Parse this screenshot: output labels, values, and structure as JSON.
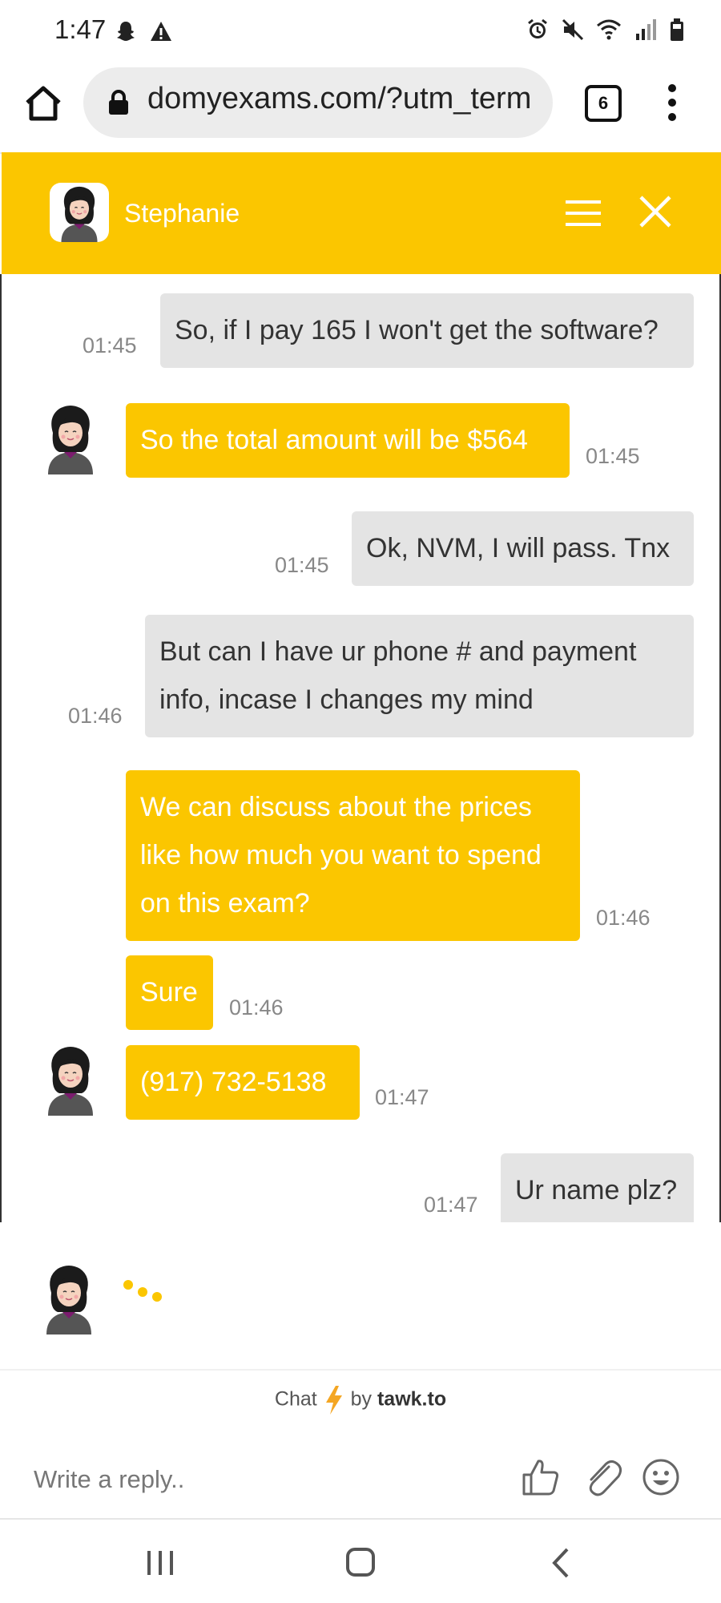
{
  "status_bar": {
    "time": "1:47"
  },
  "browser": {
    "url": "domyexams.com/?utm_term",
    "tab_count": "6"
  },
  "chat": {
    "agent_name": "Stephanie",
    "messages": [
      {
        "sender": "visitor",
        "text": "So, if I pay 165 I won't get the software?",
        "time": "01:45"
      },
      {
        "sender": "agent",
        "text": "So the total amount will be $564",
        "time": "01:45"
      },
      {
        "sender": "visitor",
        "text": "Ok, NVM, I will pass. Tnx",
        "time": "01:45"
      },
      {
        "sender": "visitor",
        "lines": [
          "But can I have ur phone # and payment",
          "info, incase I changes my mind"
        ],
        "time": "01:46"
      },
      {
        "sender": "agent",
        "lines": [
          "We can discuss about the prices",
          "like how much you want to spend",
          "on this exam?"
        ],
        "time": "01:46"
      },
      {
        "sender": "agent",
        "text": "Sure",
        "time": "01:46"
      },
      {
        "sender": "agent",
        "text": "(917) 732-5138",
        "time": "01:47"
      },
      {
        "sender": "visitor",
        "text": "Ur name plz?",
        "time": "01:47"
      }
    ]
  },
  "branding": {
    "prefix": "Chat",
    "by": "by",
    "brand": "tawk.to"
  },
  "composer": {
    "placeholder": "Write a reply.."
  },
  "colors": {
    "accent": "#fbc600",
    "visitor_bubble": "#e4e4e4",
    "text": "#333333"
  }
}
